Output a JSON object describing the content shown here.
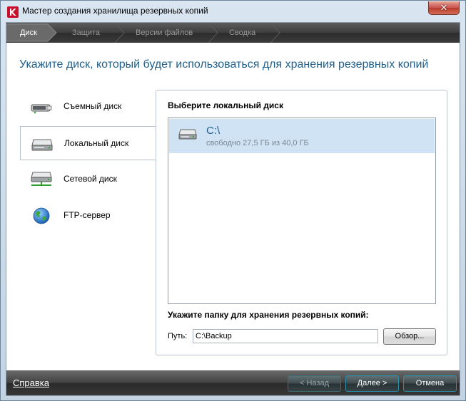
{
  "window": {
    "title": "Мастер создания хранилища резервных копий",
    "close_glyph": "✕"
  },
  "steps": [
    {
      "label": "Диск",
      "active": true
    },
    {
      "label": "Защита",
      "active": false
    },
    {
      "label": "Версии файлов",
      "active": false
    },
    {
      "label": "Сводка",
      "active": false
    }
  ],
  "page_title": "Укажите диск, который будет использоваться для хранения резервных копий",
  "storage_types": [
    {
      "label": "Съемный диск",
      "icon": "usb-drive-icon",
      "selected": false
    },
    {
      "label": "Локальный диск",
      "icon": "local-drive-icon",
      "selected": true
    },
    {
      "label": "Сетевой диск",
      "icon": "network-drive-icon",
      "selected": false
    },
    {
      "label": "FTP-сервер",
      "icon": "globe-icon",
      "selected": false
    }
  ],
  "local_disk": {
    "heading": "Выберите локальный диск",
    "disks": [
      {
        "name": "C:\\",
        "free": "свободно 27,5 ГБ из 40,0 ГБ",
        "selected": true
      }
    ]
  },
  "folder": {
    "heading": "Укажите папку для хранения резервных копий:",
    "path_label": "Путь:",
    "path_value": "C:\\Backup",
    "browse_label": "Обзор..."
  },
  "footer": {
    "help_label": "Справка",
    "back_label": "< Назад",
    "next_label": "Далее >",
    "cancel_label": "Отмена"
  },
  "colors": {
    "accent_title": "#1e5f8c",
    "selection": "#cfe3f5",
    "close_red": "#c75050"
  }
}
